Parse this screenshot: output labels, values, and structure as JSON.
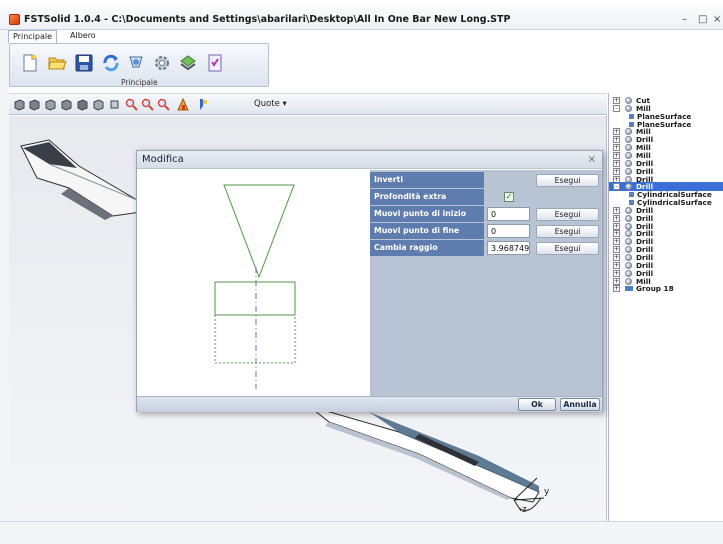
{
  "window": {
    "title": "FSTSolid 1.0.4 - C:\\Documents and Settings\\abarilari\\Desktop\\All In One Bar New Long.STP",
    "minimize": "–",
    "maximize": "□",
    "close": "×"
  },
  "ribbon": {
    "tabs": [
      {
        "label": "Principale",
        "active": true
      },
      {
        "label": "Albero",
        "active": false
      }
    ],
    "group_label": "Principale",
    "buttons": [
      "new-file-icon",
      "open-folder-icon",
      "save-icon",
      "refresh-icon",
      "tool-icon",
      "settings-gear-icon",
      "export-icon",
      "checklist-icon"
    ]
  },
  "toolbar": {
    "quote_label": "Quote"
  },
  "tree": {
    "nodes": [
      {
        "label": "Cut",
        "level": 0,
        "expander": "+",
        "kind": "ball"
      },
      {
        "label": "Mill",
        "level": 0,
        "expander": "-",
        "kind": "ball"
      },
      {
        "label": "PlaneSurface",
        "level": 1,
        "expander": "",
        "kind": "square"
      },
      {
        "label": "PlaneSurface",
        "level": 1,
        "expander": "",
        "kind": "square"
      },
      {
        "label": "Mill",
        "level": 0,
        "expander": "+",
        "kind": "ball"
      },
      {
        "label": "Drill",
        "level": 0,
        "expander": "+",
        "kind": "ball"
      },
      {
        "label": "Mill",
        "level": 0,
        "expander": "+",
        "kind": "ball"
      },
      {
        "label": "Mill",
        "level": 0,
        "expander": "+",
        "kind": "ball"
      },
      {
        "label": "Drill",
        "level": 0,
        "expander": "+",
        "kind": "ball"
      },
      {
        "label": "Drill",
        "level": 0,
        "expander": "+",
        "kind": "ball"
      },
      {
        "label": "Drill",
        "level": 0,
        "expander": "+",
        "kind": "ball"
      },
      {
        "label": "Drill",
        "level": 0,
        "expander": "-",
        "kind": "ball",
        "selected": true
      },
      {
        "label": "CylindricalSurface",
        "level": 1,
        "expander": "",
        "kind": "square"
      },
      {
        "label": "CylindricalSurface",
        "level": 1,
        "expander": "",
        "kind": "square"
      },
      {
        "label": "Drill",
        "level": 0,
        "expander": "+",
        "kind": "ball"
      },
      {
        "label": "Drill",
        "level": 0,
        "expander": "+",
        "kind": "ball"
      },
      {
        "label": "Drill",
        "level": 0,
        "expander": "+",
        "kind": "ball"
      },
      {
        "label": "Drill",
        "level": 0,
        "expander": "+",
        "kind": "ball"
      },
      {
        "label": "Drill",
        "level": 0,
        "expander": "+",
        "kind": "ball"
      },
      {
        "label": "Drill",
        "level": 0,
        "expander": "+",
        "kind": "ball"
      },
      {
        "label": "Drill",
        "level": 0,
        "expander": "+",
        "kind": "ball"
      },
      {
        "label": "Drill",
        "level": 0,
        "expander": "+",
        "kind": "ball"
      },
      {
        "label": "Drill",
        "level": 0,
        "expander": "+",
        "kind": "ball"
      },
      {
        "label": "Mill",
        "level": 0,
        "expander": "+",
        "kind": "ball"
      },
      {
        "label": "Group 18",
        "level": 0,
        "expander": "+",
        "kind": "group"
      }
    ]
  },
  "dialog": {
    "title": "Modifica",
    "close": "×",
    "rows": [
      {
        "label": "Inverti",
        "value": "",
        "control": "none",
        "button": "Esegui"
      },
      {
        "label": "Profondità extra",
        "value": "✓",
        "control": "checkbox",
        "button": ""
      },
      {
        "label": "Muovi punto di inizio",
        "value": "0",
        "control": "input",
        "button": "Esegui"
      },
      {
        "label": "Muovi punto di fine",
        "value": "0",
        "control": "input",
        "button": "Esegui"
      },
      {
        "label": "Cambia raggio",
        "value": "3.968749!",
        "control": "input",
        "button": "Esegui"
      }
    ],
    "ok_label": "Ok",
    "cancel_label": "Annulla"
  },
  "viewport": {
    "axis_y": "y",
    "axis_z": "z"
  },
  "colors": {
    "preview_stroke": "#4f9a44",
    "selected": "#3a6fd8",
    "prop_label_bg": "#5f7cae"
  }
}
